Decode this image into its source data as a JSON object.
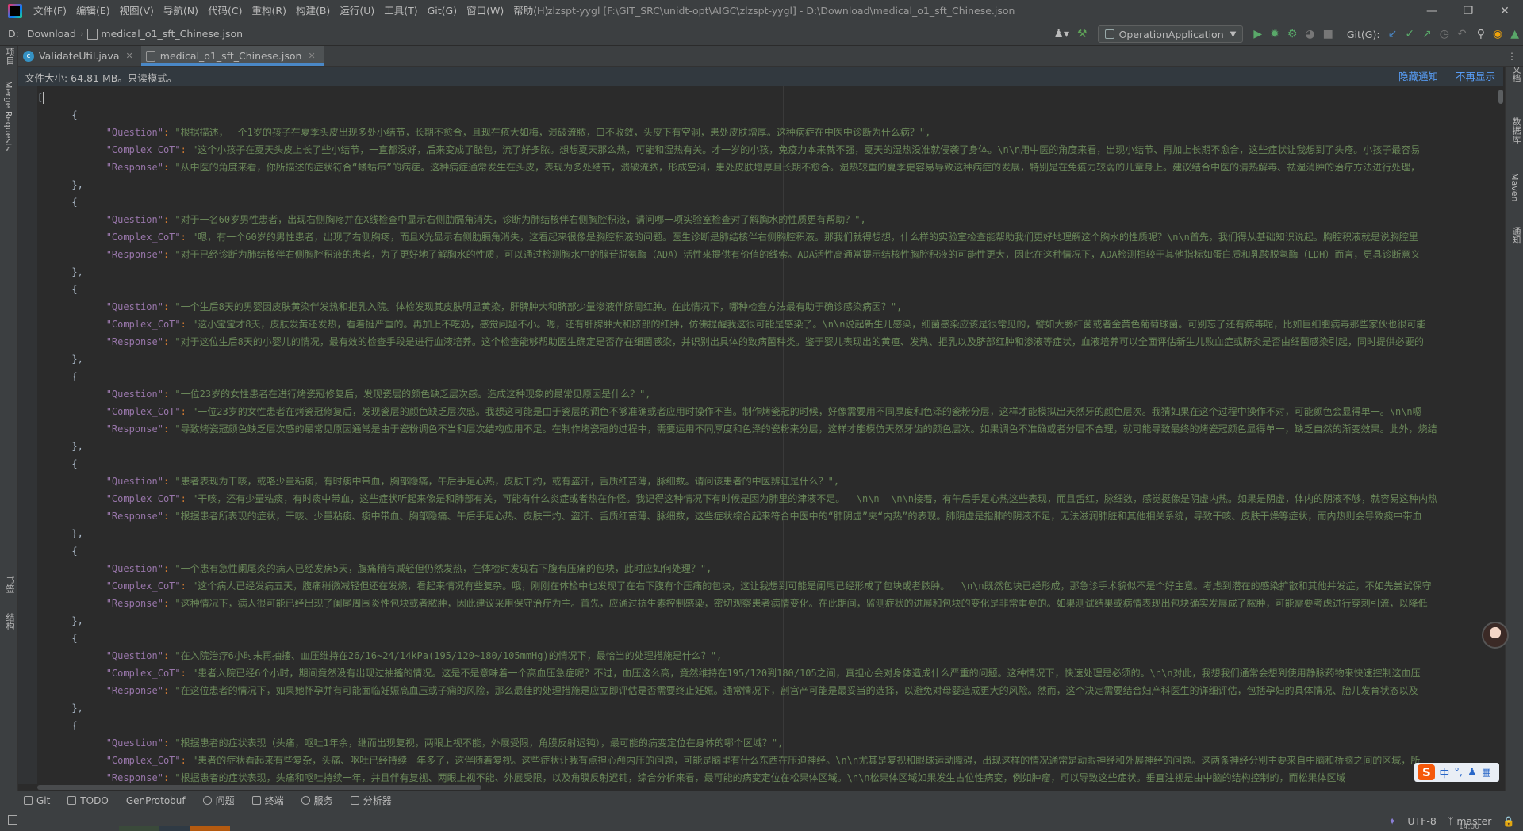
{
  "menubar": {
    "items": [
      "文件(F)",
      "编辑(E)",
      "视图(V)",
      "导航(N)",
      "代码(C)",
      "重构(R)",
      "构建(B)",
      "运行(U)",
      "工具(T)",
      "Git(G)",
      "窗口(W)",
      "帮助(H)"
    ],
    "window_title": "zlzspt-yygl [F:\\GIT_SRC\\unidt-opt\\AIGC\\zlzspt-yygl] - D:\\Download\\medical_o1_sft_Chinese.json"
  },
  "navbar": {
    "drive": "D:",
    "crumbs": [
      "Download",
      "medical_o1_sft_Chinese.json"
    ],
    "run_config": "OperationApplication",
    "git_label": "Git(G):"
  },
  "tabs": [
    {
      "label": "ValidateUtil.java",
      "type": "java",
      "active": false
    },
    {
      "label": "medical_o1_sft_Chinese.json",
      "type": "json",
      "active": true
    }
  ],
  "banner": {
    "message": "文件大小: 64.81 MB。只读模式。",
    "hide_link": "隐藏通知",
    "dismiss_link": "不再显示"
  },
  "left_strip": {
    "project": "项目",
    "merge_requests": "Merge Requests",
    "bookmarks": "书签",
    "structure": "结构"
  },
  "right_strip": {
    "remote": "远程文档",
    "database": "数据库",
    "maven": "Maven",
    "notifications": "通知"
  },
  "editor": {
    "lines": [
      {
        "indent": 0,
        "content": "["
      },
      {
        "indent": 1,
        "content": "{"
      },
      {
        "indent": 2,
        "key": "\"Question\"",
        "value": "\"根据描述，一个1岁的孩子在夏季头皮出现多处小结节，长期不愈合，且现在疮大如梅，溃破流脓，口不收敛，头皮下有空洞，患处皮肤增厚。这种病症在中医中诊断为什么病？\","
      },
      {
        "indent": 2,
        "key": "\"Complex_CoT\"",
        "value": "\"这个小孩子在夏天头皮上长了些小结节，一直都没好，后来变成了脓包，流了好多脓。想想夏天那么热，可能和湿热有关。才一岁的小孩，免疫力本来就不强，夏天的湿热没准就侵袭了身体。\\n\\n用中医的角度来看，出现小结节、再加上长期不愈合，这些症状让我想到了头疮。小孩子最容易"
      },
      {
        "indent": 2,
        "key": "\"Response\"",
        "value": "\"从中医的角度来看，你所描述的症状符合“蝼蛄疖”的病症。这种病症通常发生在头皮，表现为多处结节，溃破流脓，形成空洞，患处皮肤增厚且长期不愈合。湿热较重的夏季更容易导致这种病症的发展，特别是在免疫力较弱的儿童身上。建议结合中医的清热解毒、祛湿消肿的治疗方法进行处理，"
      },
      {
        "indent": 1,
        "content": "},"
      },
      {
        "indent": 1,
        "content": "{"
      },
      {
        "indent": 2,
        "key": "\"Question\"",
        "value": "\"对于一名60岁男性患者，出现右侧胸疼并在X线检查中显示右侧肋膈角消失，诊断为肺结核伴右侧胸腔积液，请问哪一项实验室检查对了解胸水的性质更有帮助？\","
      },
      {
        "indent": 2,
        "key": "\"Complex_CoT\"",
        "value": "\"嗯，有一个60岁的男性患者，出现了右侧胸疼，而且X光显示右侧肋膈角消失，这看起来很像是胸腔积液的问题。医生诊断是肺结核伴右侧胸腔积液。那我们就得想想，什么样的实验室检查能帮助我们更好地理解这个胸水的性质呢？\\n\\n首先，我们得从基础知识说起。胸腔积液就是说胸腔里"
      },
      {
        "indent": 2,
        "key": "\"Response\"",
        "value": "\"对于已经诊断为肺结核伴右侧胸腔积液的患者，为了更好地了解胸水的性质，可以通过检测胸水中的腺苷脱氨酶（ADA）活性来提供有价值的线索。ADA活性高通常提示结核性胸腔积液的可能性更大，因此在这种情况下，ADA检测相较于其他指标如蛋白质和乳酸脱氢酶（LDH）而言，更具诊断意义"
      },
      {
        "indent": 1,
        "content": "},"
      },
      {
        "indent": 1,
        "content": "{"
      },
      {
        "indent": 2,
        "key": "\"Question\"",
        "value": "\"一个生后8天的男婴因皮肤黄染伴发热和拒乳入院。体检发现其皮肤明显黄染，肝脾肿大和脐部少量渗液伴脐周红肿。在此情况下，哪种检查方法最有助于确诊感染病因？\","
      },
      {
        "indent": 2,
        "key": "\"Complex_CoT\"",
        "value": "\"这小宝宝才8天，皮肤发黄还发热，看着挺严重的。再加上不吃奶，感觉问题不小。嗯，还有肝脾肿大和脐部的红肿，仿佛提醒我这很可能是感染了。\\n\\n说起新生儿感染，细菌感染应该是很常见的，譬如大肠杆菌或者金黄色葡萄球菌。可别忘了还有病毒呢，比如巨细胞病毒那些家伙也很可能"
      },
      {
        "indent": 2,
        "key": "\"Response\"",
        "value": "\"对于这位生后8天的小婴儿的情况，最有效的检查手段是进行血液培养。这个检查能够帮助医生确定是否存在细菌感染，并识别出具体的致病菌种类。鉴于婴儿表现出的黄疸、发热、拒乳以及脐部红肿和渗液等症状，血液培养可以全面评估新生儿败血症或脐炎是否由细菌感染引起，同时提供必要的"
      },
      {
        "indent": 1,
        "content": "},"
      },
      {
        "indent": 1,
        "content": "{"
      },
      {
        "indent": 2,
        "key": "\"Question\"",
        "value": "\"一位23岁的女性患者在进行烤瓷冠修复后，发现瓷层的颜色缺乏层次感。造成这种现象的最常见原因是什么？\","
      },
      {
        "indent": 2,
        "key": "\"Complex_CoT\"",
        "value": "\"一位23岁的女性患者在烤瓷冠修复后，发现瓷层的颜色缺乏层次感。我想这可能是由于瓷层的调色不够准确或者应用时操作不当。制作烤瓷冠的时候，好像需要用不同厚度和色泽的瓷粉分层，这样才能模拟出天然牙的颜色层次。我猜如果在这个过程中操作不对，可能颜色会显得单一。\\n\\n嗯"
      },
      {
        "indent": 2,
        "key": "\"Response\"",
        "value": "\"导致烤瓷冠颜色缺乏层次感的最常见原因通常是由于瓷粉调色不当和层次结构应用不足。在制作烤瓷冠的过程中，需要运用不同厚度和色泽的瓷粉来分层，这样才能模仿天然牙齿的颜色层次。如果调色不准确或者分层不合理，就可能导致最终的烤瓷冠颜色显得单一，缺乏自然的渐变效果。此外，烧结"
      },
      {
        "indent": 1,
        "content": "},"
      },
      {
        "indent": 1,
        "content": "{"
      },
      {
        "indent": 2,
        "key": "\"Question\"",
        "value": "\"患者表现为干咳，或咯少量粘痰，有时痰中带血，胸部隐痛，午后手足心热，皮肤干灼，或有盗汗，舌质红苔薄，脉细数。请问该患者的中医辨证是什么？\","
      },
      {
        "indent": 2,
        "key": "\"Complex_CoT\"",
        "value": "\"干咳，还有少量粘痰，有时痰中带血，这些症状听起来像是和肺部有关，可能有什么炎症或者热在作怪。我记得这种情况下有时候是因为肺里的津液不足。  \\n\\n  \\n\\n接着，有午后手足心热这些表现，而且舌红，脉细数，感觉挺像是阴虚内热。如果是阴虚，体内的阴液不够，就容易这种内热"
      },
      {
        "indent": 2,
        "key": "\"Response\"",
        "value": "\"根据患者所表现的症状，干咳、少量粘痰、痰中带血、胸部隐痛、午后手足心热、皮肤干灼、盗汗、舌质红苔薄、脉细数，这些症状综合起来符合中医中的“肺阴虚”夹“内热”的表现。肺阴虚是指肺的阴液不足，无法滋润肺脏和其他相关系统，导致干咳、皮肤干燥等症状，而内热则会导致痰中带血"
      },
      {
        "indent": 1,
        "content": "},"
      },
      {
        "indent": 1,
        "content": "{"
      },
      {
        "indent": 2,
        "key": "\"Question\"",
        "value": "\"一个患有急性阑尾炎的病人已经发病5天，腹痛稍有减轻但仍然发热，在体检时发现右下腹有压痛的包块，此时应如何处理？\","
      },
      {
        "indent": 2,
        "key": "\"Complex_CoT\"",
        "value": "\"这个病人已经发病五天，腹痛稍微减轻但还在发烧，看起来情况有些复杂。哦，刚刚在体检中也发现了在右下腹有个压痛的包块，这让我想到可能是阑尾已经形成了包块或者脓肿。  \\n\\n既然包块已经形成，那急诊手术貌似不是个好主意。考虑到潜在的感染扩散和其他并发症，不如先尝试保守"
      },
      {
        "indent": 2,
        "key": "\"Response\"",
        "value": "\"这种情况下，病人很可能已经出现了阑尾周围炎性包块或者脓肿，因此建议采用保守治疗为主。首先，应通过抗生素控制感染，密切观察患者病情变化。在此期间，监测症状的进展和包块的变化是非常重要的。如果测试结果或病情表现出包块确实发展成了脓肿，可能需要考虑进行穿刺引流，以降低"
      },
      {
        "indent": 1,
        "content": "},"
      },
      {
        "indent": 1,
        "content": "{"
      },
      {
        "indent": 2,
        "key": "\"Question\"",
        "value": "\"在入院治疗6小时未再抽搐、血压维持在26/16~24/14kPa(195/120~180/105mmHg)的情况下，最恰当的处理措施是什么？\","
      },
      {
        "indent": 2,
        "key": "\"Complex_CoT\"",
        "value": "\"患者入院已经6个小时，期间竟然没有出现过抽搐的情况。这是不是意味着一个高血压急症呢？不过，血压这么高，竟然维持在195/120到180/105之间，真担心会对身体造成什么严重的问题。这种情况下，快速处理是必须的。\\n\\n对此，我想我们通常会想到使用静脉药物来快速控制这血压"
      },
      {
        "indent": 2,
        "key": "\"Response\"",
        "value": "\"在这位患者的情况下，如果她怀孕并有可能面临妊娠高血压或子痫的风险，那么最佳的处理措施是应立即评估是否需要终止妊娠。通常情况下，剖宫产可能是最妥当的选择，以避免对母婴造成更大的风险。然而，这个决定需要结合妇产科医生的详细评估，包括孕妇的具体情况、胎儿发育状态以及"
      },
      {
        "indent": 1,
        "content": "},"
      },
      {
        "indent": 1,
        "content": "{"
      },
      {
        "indent": 2,
        "key": "\"Question\"",
        "value": "\"根据患者的症状表现（头痛，呕吐1年余，继而出现复视，两眼上视不能，外展受限，角膜反射迟钝），最可能的病变定位在身体的哪个区域？\","
      },
      {
        "indent": 2,
        "key": "\"Complex_CoT\"",
        "value": "\"患者的症状看起来有些复杂，头痛、呕吐已经持续一年多了，这伴随着复视。这些症状让我有点担心颅内压的问题，可能是脑里有什么东西在压迫神经。\\n\\n尤其是复视和眼球运动障碍，出现这样的情况通常是动眼神经和外展神经的问题。这两条神经分别主要来自中脑和桥脑之间的区域，所"
      },
      {
        "indent": 2,
        "key": "\"Response\"",
        "value": "\"根据患者的症状表现，头痛和呕吐持续一年，并且伴有复视、两眼上视不能、外展受限，以及角膜反射迟钝，综合分析来看，最可能的病变定位在松果体区域。\\n\\n松果体区域如果发生占位性病变，例如肿瘤，可以导致这些症状。垂直注视是由中脑的结构控制的，而松果体区域"
      }
    ]
  },
  "bottom_tools": [
    "Git",
    "TODO",
    "GenProtobuf",
    "问题",
    "终端",
    "服务",
    "分析器"
  ],
  "statusbar": {
    "encoding": "UTF-8",
    "branch": "master",
    "time": "14:00"
  },
  "ime": {
    "mode": "中"
  },
  "colors": {
    "key": "#9876aa",
    "string": "#6a8759",
    "punctuation": "#cc7832",
    "link": "#589df6",
    "accent": "#4a88c7"
  }
}
